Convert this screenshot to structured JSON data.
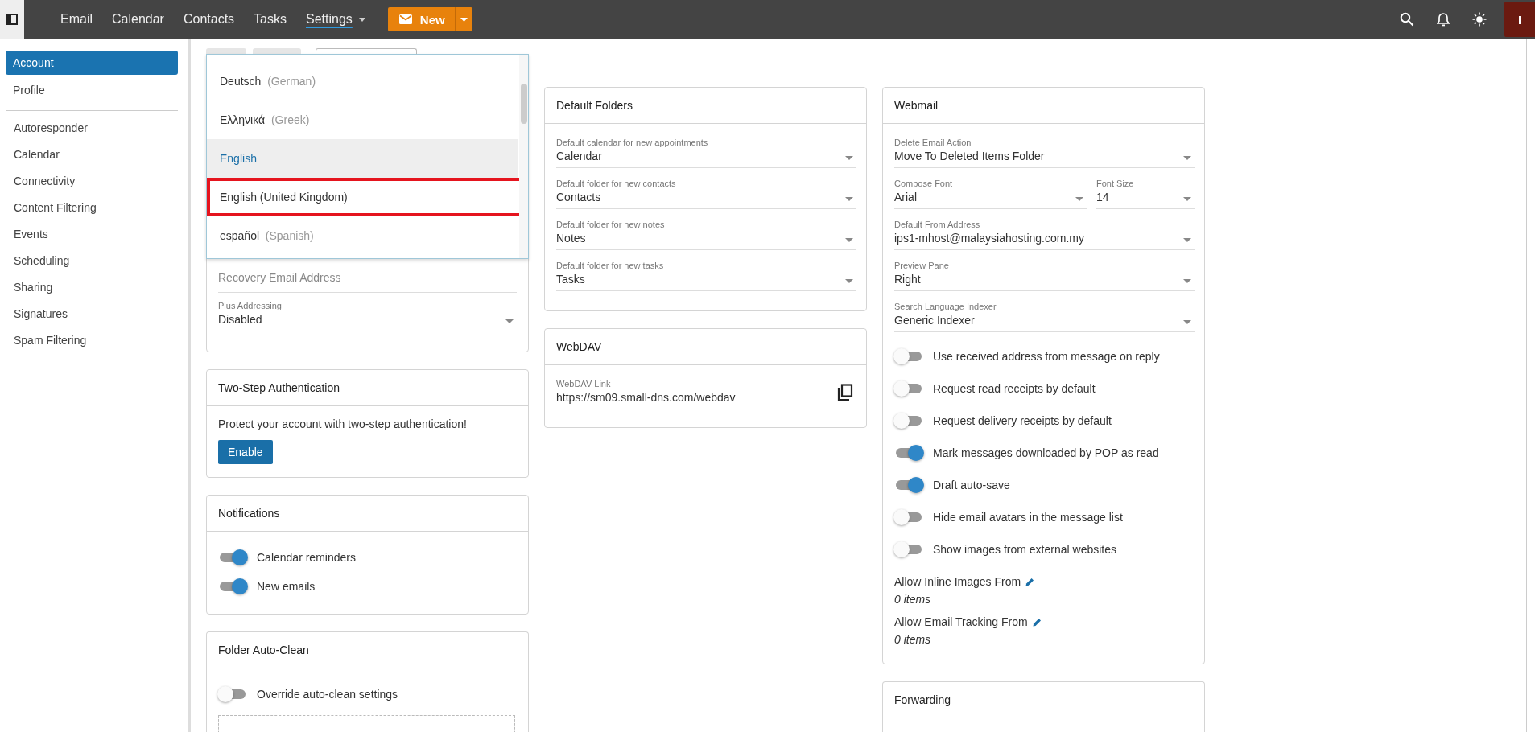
{
  "top_bar": {
    "nav": [
      {
        "label": "Email",
        "selected": false,
        "has_menu": false
      },
      {
        "label": "Calendar",
        "selected": false,
        "has_menu": false
      },
      {
        "label": "Contacts",
        "selected": false,
        "has_menu": false
      },
      {
        "label": "Tasks",
        "selected": false,
        "has_menu": false
      },
      {
        "label": "Settings",
        "selected": true,
        "has_menu": true
      }
    ],
    "new_button": {
      "label": "New"
    },
    "avatar": {
      "initial": "I"
    }
  },
  "sidebar": {
    "sections": [
      {
        "items": [
          {
            "label": "Account",
            "selected": true
          },
          {
            "label": "Profile",
            "selected": false
          }
        ]
      },
      {
        "items": [
          {
            "label": "Autoresponder",
            "selected": false
          },
          {
            "label": "Calendar",
            "selected": false
          },
          {
            "label": "Connectivity",
            "selected": false
          },
          {
            "label": "Content Filtering",
            "selected": false
          },
          {
            "label": "Events",
            "selected": false
          },
          {
            "label": "Scheduling",
            "selected": false
          },
          {
            "label": "Sharing",
            "selected": false
          },
          {
            "label": "Signatures",
            "selected": false
          },
          {
            "label": "Spam Filtering",
            "selected": false
          }
        ]
      }
    ]
  },
  "account_card": {
    "tabs": [
      {
        "selected": false
      },
      {
        "selected": false
      },
      {
        "selected": true
      }
    ],
    "language_dropdown": {
      "options": [
        {
          "label": "Deutsch",
          "note": "(German)",
          "selected": false,
          "annotated": false
        },
        {
          "label": "Ελληνικά",
          "note": "(Greek)",
          "selected": false,
          "annotated": false
        },
        {
          "label": "English",
          "selected": true,
          "annotated": false
        },
        {
          "label": "English (United Kingdom)",
          "selected": false,
          "annotated": true
        },
        {
          "label": "español",
          "note": "(Spanish)",
          "selected": false,
          "annotated": false
        }
      ]
    },
    "recovery_email": {
      "placeholder": "Recovery Email Address"
    },
    "plus_addressing": {
      "label": "Plus Addressing",
      "value": "Disabled"
    }
  },
  "two_step": {
    "title": "Two-Step Authentication",
    "text": "Protect your account with two-step authentication!",
    "button": "Enable"
  },
  "notifications": {
    "title": "Notifications",
    "toggles": [
      {
        "label": "Calendar reminders",
        "on": true
      },
      {
        "label": "New emails",
        "on": true
      }
    ]
  },
  "folder_auto_clean": {
    "title": "Folder Auto-Clean",
    "toggles": [
      {
        "label": "Override auto-clean settings",
        "on": false
      }
    ]
  },
  "default_folders": {
    "title": "Default Folders",
    "fields": [
      {
        "label": "Default calendar for new appointments",
        "value": "Calendar"
      },
      {
        "label": "Default folder for new contacts",
        "value": "Contacts"
      },
      {
        "label": "Default folder for new notes",
        "value": "Notes"
      },
      {
        "label": "Default folder for new tasks",
        "value": "Tasks"
      }
    ]
  },
  "webdav": {
    "title": "WebDAV",
    "field": {
      "label": "WebDAV Link",
      "value": "https://sm09.small-dns.com/webdav"
    }
  },
  "webmail": {
    "title": "Webmail",
    "rows": [
      [
        {
          "label": "Delete Email Action",
          "value": "Move To Deleted Items Folder"
        }
      ],
      [
        {
          "label": "Compose Font",
          "value": "Arial"
        },
        {
          "label": "Font Size",
          "value": "14"
        }
      ],
      [
        {
          "label": "Default From Address",
          "value": "ips1-mhost@malaysiahosting.com.my"
        }
      ],
      [
        {
          "label": "Preview Pane",
          "value": "Right"
        }
      ],
      [
        {
          "label": "Search Language Indexer",
          "value": "Generic Indexer"
        }
      ]
    ],
    "toggles": [
      {
        "label": "Use received address from message on reply",
        "on": false
      },
      {
        "label": "Request read receipts by default",
        "on": false
      },
      {
        "label": "Request delivery receipts by default",
        "on": false
      },
      {
        "label": "Mark messages downloaded by POP as read",
        "on": true
      },
      {
        "label": "Draft auto-save",
        "on": true
      },
      {
        "label": "Hide email avatars in the message list",
        "on": false
      },
      {
        "label": "Show images from external websites",
        "on": false
      }
    ],
    "lists": [
      {
        "label": "Allow Inline Images From",
        "count": "0 items"
      },
      {
        "label": "Allow Email Tracking From",
        "count": "0 items"
      }
    ]
  },
  "forwarding": {
    "title": "Forwarding"
  }
}
